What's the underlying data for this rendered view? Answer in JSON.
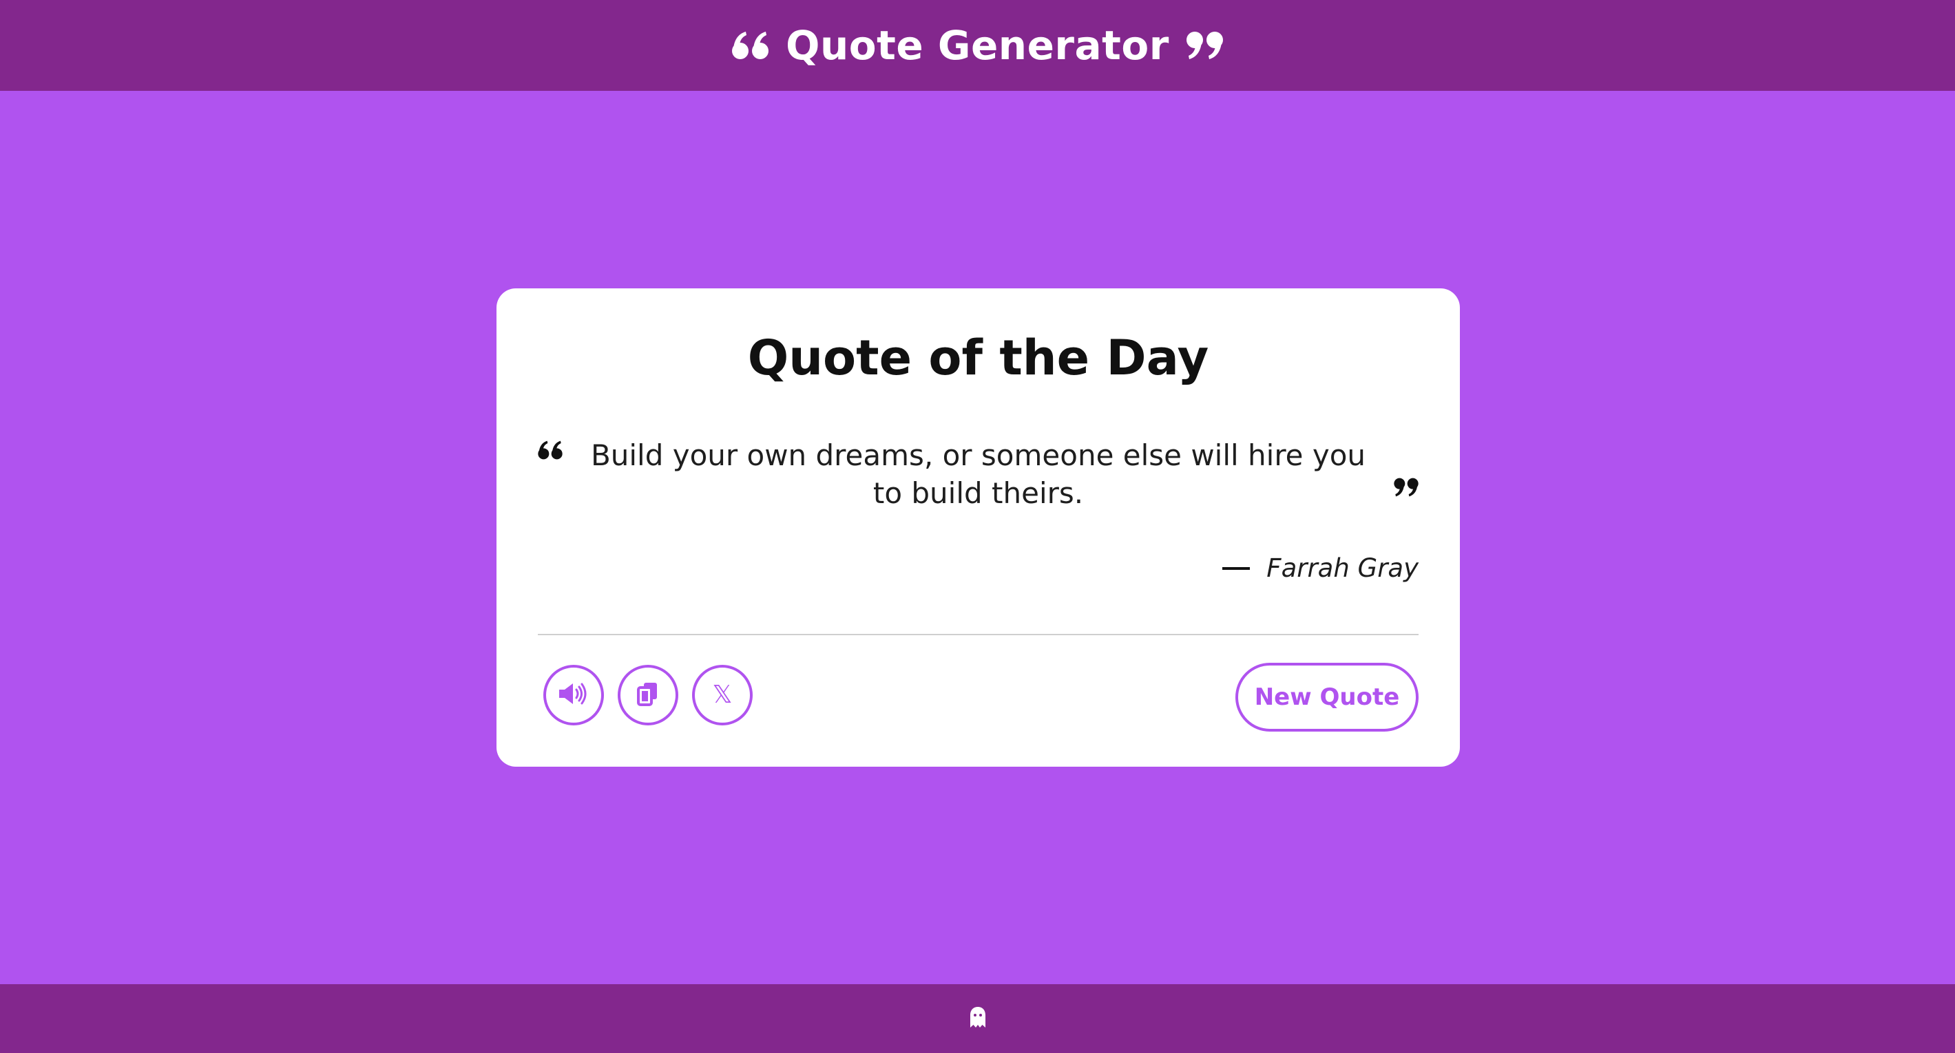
{
  "header": {
    "title": "Quote Generator",
    "left_icon": "quote-left-icon",
    "right_icon": "quote-right-icon"
  },
  "card": {
    "title": "Quote of the Day",
    "quote": "Build your own dreams, or someone else will hire you to build theirs.",
    "author": "Farrah Gray"
  },
  "actions": {
    "speak_icon": "volume-icon",
    "copy_icon": "copy-icon",
    "share_icon": "x-twitter-icon",
    "share_glyph": "𝕏",
    "new_quote_label": "New Quote"
  },
  "footer": {
    "icon": "ghost-icon"
  },
  "colors": {
    "background": "#b053ef",
    "bar": "#83278d",
    "card": "#ffffff",
    "accent": "#b053ef",
    "text": "#1e1e1e"
  }
}
